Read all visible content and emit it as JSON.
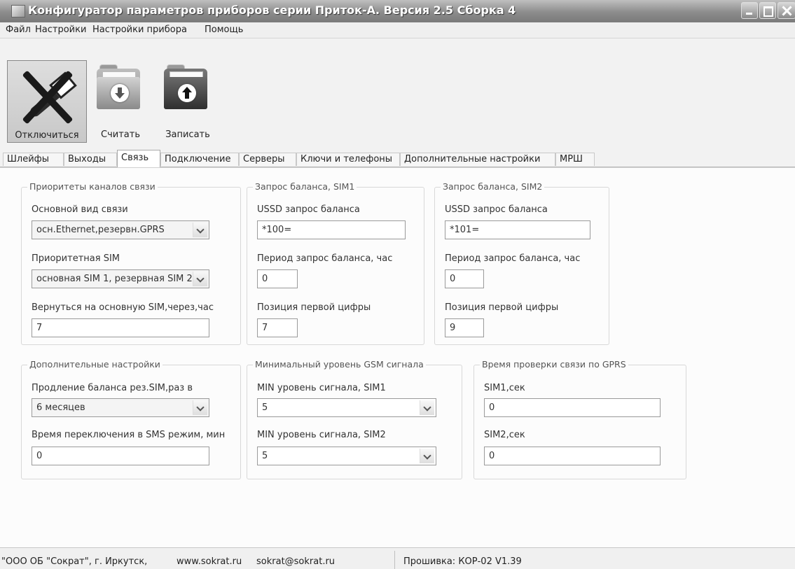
{
  "window": {
    "title": "Конфигуратор параметров приборов серии Приток-А. Версия 2.5 Сборка 4"
  },
  "menu": [
    "Файл",
    "Настройки",
    "Настройки прибора",
    "Помощь"
  ],
  "toolbar": {
    "disconnect": "Отключиться",
    "read": "Считать",
    "write": "Записать"
  },
  "tabs": [
    "Шлейфы",
    "Выходы",
    "Связь",
    "Подключение",
    "Серверы",
    "Ключи и телефоны",
    "Дополнительные настройки",
    "МРШ"
  ],
  "active_tab": "Связь",
  "groups": {
    "priority": {
      "title": "Приоритеты каналов связи",
      "main_type_label": "Основной вид связи",
      "main_type_value": "осн.Ethernet,резервн.GPRS",
      "priority_sim_label": "Приоритетная SIM",
      "priority_sim_value": "основная SIM 1, резервная SIM 2",
      "return_label": "Вернуться на основную SIM,через,час",
      "return_value": "7"
    },
    "balance_sim1": {
      "title": "Запрос баланса, SIM1",
      "ussd_label": "USSD запрос баланса",
      "ussd_value": "*100=",
      "period_label": "Период запрос баланса, час",
      "period_value": "0",
      "position_label": "Позиция первой цифры",
      "position_value": "7"
    },
    "balance_sim2": {
      "title": "Запрос баланса, SIM2",
      "ussd_label": "USSD запрос баланса",
      "ussd_value": "*101=",
      "period_label": "Период запрос баланса, час",
      "period_value": "0",
      "position_label": "Позиция первой цифры",
      "position_value": "9"
    },
    "extra": {
      "title": "Дополнительные настройки",
      "extend_label": "Продление баланса рез.SIM,раз в",
      "extend_value": "6 месяцев",
      "sms_label": "Время переключения в SMS режим, мин",
      "sms_value": "0"
    },
    "gsm": {
      "title": "Минимальный уровень GSM сигнала",
      "sim1_label": "MIN уровень сигнала, SIM1",
      "sim1_value": "5",
      "sim2_label": "MIN уровень сигнала, SIM2",
      "sim2_value": "5"
    },
    "gprs": {
      "title": "Время проверки связи по GPRS",
      "sim1_label": "SIM1,сек",
      "sim1_value": "0",
      "sim2_label": "SIM2,сек",
      "sim2_value": "0"
    }
  },
  "status": {
    "company": "\"ООО ОБ \"Сократ\", г. Иркутск,",
    "site": "www.sokrat.ru",
    "email": "sokrat@sokrat.ru",
    "firmware": "Прошивка: КОР-02 V1.39"
  }
}
